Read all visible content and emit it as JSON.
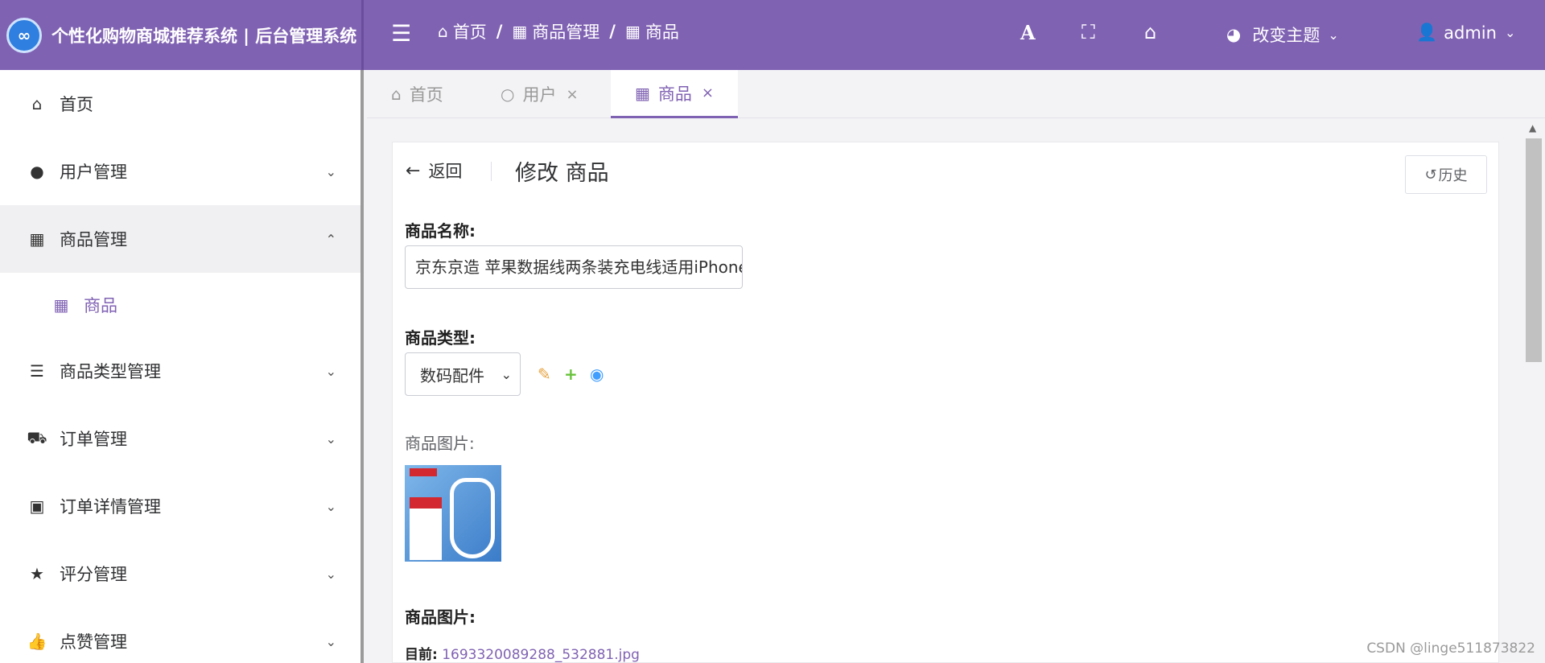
{
  "header": {
    "brand_logo": "∞",
    "brand_title": "个性化购物商城推荐系统 | 后台管理系统",
    "breadcrumbs": [
      "首页",
      "商品管理",
      "商品"
    ],
    "theme_label": "改变主题",
    "user_label": "admin"
  },
  "sidebar": {
    "items": [
      {
        "label": "首页",
        "icon": "home-icon"
      },
      {
        "label": "用户管理",
        "icon": "user-icon"
      },
      {
        "label": "商品管理",
        "icon": "gifts-icon"
      },
      {
        "label": "商品",
        "icon": "gifts-icon"
      },
      {
        "label": "商品类型管理",
        "icon": "list-icon"
      },
      {
        "label": "订单管理",
        "icon": "truck-icon"
      },
      {
        "label": "订单详情管理",
        "icon": "bag-icon"
      },
      {
        "label": "评分管理",
        "icon": "star-icon"
      },
      {
        "label": "点赞管理",
        "icon": "thumbs-up-icon"
      }
    ]
  },
  "tabs": [
    {
      "label": "首页"
    },
    {
      "label": "用户"
    },
    {
      "label": "商品"
    }
  ],
  "form": {
    "back_label": "返回",
    "title": "修改 商品",
    "history_label": "历史",
    "name_label": "商品名称:",
    "name_value": "京东京造 苹果数据线两条装充电线适用iPhone",
    "type_label": "商品类型:",
    "type_value": "数码配件",
    "image_label": "商品图片:",
    "image_label2": "商品图片:",
    "current_prefix": "目前:",
    "current_file": "1693320089288_532881.jpg"
  },
  "watermark": "CSDN @linge511873822",
  "colors": {
    "accent": "#8062b3",
    "edit_icon": "#e6a23c",
    "add_icon": "#67c23a",
    "view_icon": "#409eff"
  }
}
